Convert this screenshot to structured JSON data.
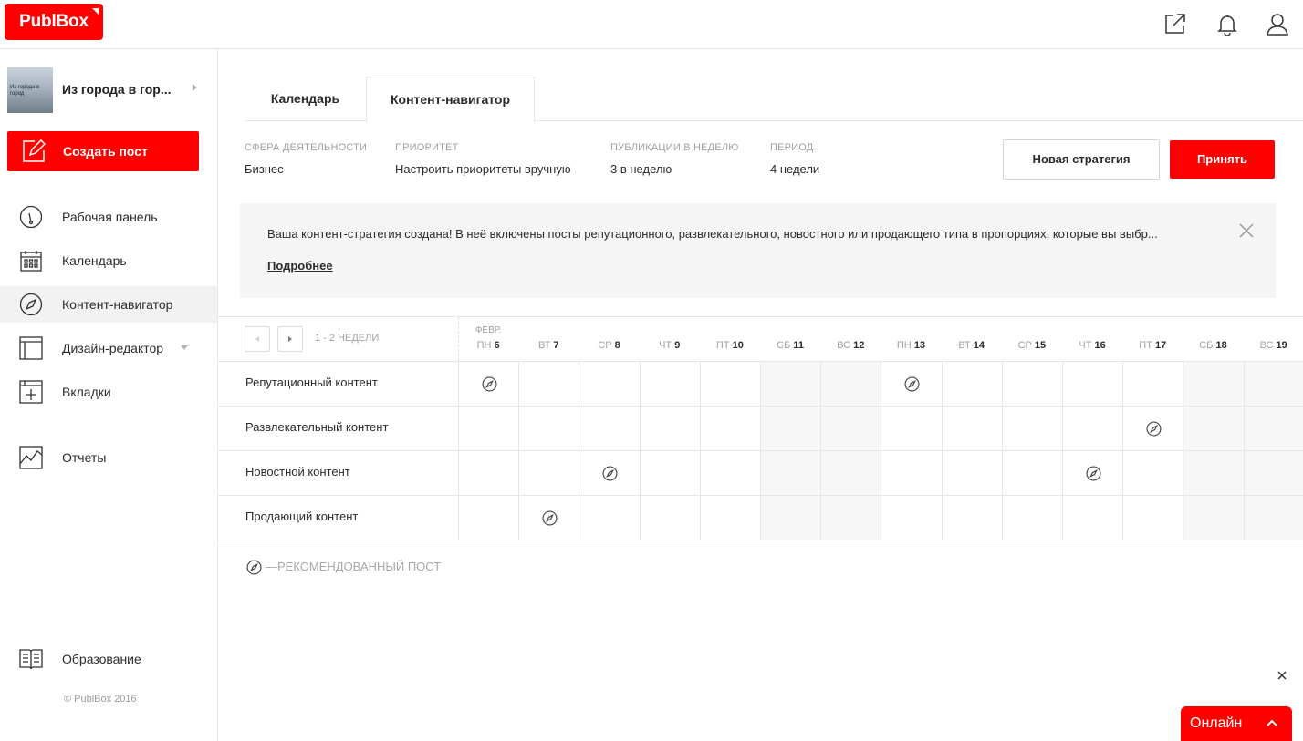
{
  "header": {
    "logo": "PublBox",
    "icons": [
      "external-link-icon",
      "bell-icon",
      "user-icon"
    ]
  },
  "sidebar": {
    "project_name": "Из города в гор...",
    "project_thumb_text": "Из города в город",
    "create_label": "Создать пост",
    "items": [
      {
        "label": "Рабочая панель",
        "icon": "dashboard-icon"
      },
      {
        "label": "Календарь",
        "icon": "calendar-icon"
      },
      {
        "label": "Контент-навигатор",
        "icon": "compass-icon"
      },
      {
        "label": "Дизайн-редактор",
        "icon": "design-editor-icon"
      },
      {
        "label": "Вкладки",
        "icon": "tabs-icon"
      },
      {
        "label": "Отчеты",
        "icon": "reports-icon"
      }
    ],
    "education_label": "Образование",
    "copyright": "© PublBox 2016"
  },
  "tabs": [
    {
      "label": "Календарь"
    },
    {
      "label": "Контент-навигатор"
    }
  ],
  "params": [
    {
      "key": "СФЕРА ДЕЯТЕЛЬНОСТИ",
      "value": "Бизнес"
    },
    {
      "key": "ПРИОРИТЕТ",
      "value": "Настроить приоритеты вручную"
    },
    {
      "key": "ПУБЛИКАЦИИ В НЕДЕЛЮ",
      "value": "3 в неделю"
    },
    {
      "key": "ПЕРИОД",
      "value": "4 недели"
    }
  ],
  "buttons": {
    "new_strategy": "Новая стратегия",
    "accept": "Принять"
  },
  "notice": {
    "text": "Ваша контент-стратегия создана! В неё включены посты репутационного, развлекательного, новостного или продающего типа в пропорциях, которые вы выбр...",
    "more": "Подробнее"
  },
  "grid": {
    "pager_label": "1 - 2 НЕДЕЛИ",
    "month": "ФЕВР.",
    "days": [
      {
        "dow": "ПН",
        "num": "6"
      },
      {
        "dow": "ВТ",
        "num": "7"
      },
      {
        "dow": "СР",
        "num": "8"
      },
      {
        "dow": "ЧТ",
        "num": "9"
      },
      {
        "dow": "ПТ",
        "num": "10"
      },
      {
        "dow": "СБ",
        "num": "11"
      },
      {
        "dow": "ВС",
        "num": "12"
      },
      {
        "dow": "ПН",
        "num": "13"
      },
      {
        "dow": "ВТ",
        "num": "14"
      },
      {
        "dow": "СР",
        "num": "15"
      },
      {
        "dow": "ЧТ",
        "num": "16"
      },
      {
        "dow": "ПТ",
        "num": "17"
      },
      {
        "dow": "СБ",
        "num": "18"
      },
      {
        "dow": "ВС",
        "num": "19"
      }
    ],
    "weekend_columns": [
      5,
      6,
      12,
      13
    ],
    "rows": [
      {
        "label": "Репутационный контент",
        "marks": [
          0,
          7
        ]
      },
      {
        "label": "Развлекательный контент",
        "marks": [
          11
        ]
      },
      {
        "label": "Новостной контент",
        "marks": [
          2,
          10
        ]
      },
      {
        "label": "Продающий контент",
        "marks": [
          1
        ]
      }
    ]
  },
  "legend": "—РЕКОМЕНДОВАННЫЙ ПОСТ",
  "chat": {
    "label": "Онлайн"
  },
  "colors": {
    "accent": "#ff0000",
    "border": "#e6e6e6",
    "muted": "#a0a0a0"
  }
}
